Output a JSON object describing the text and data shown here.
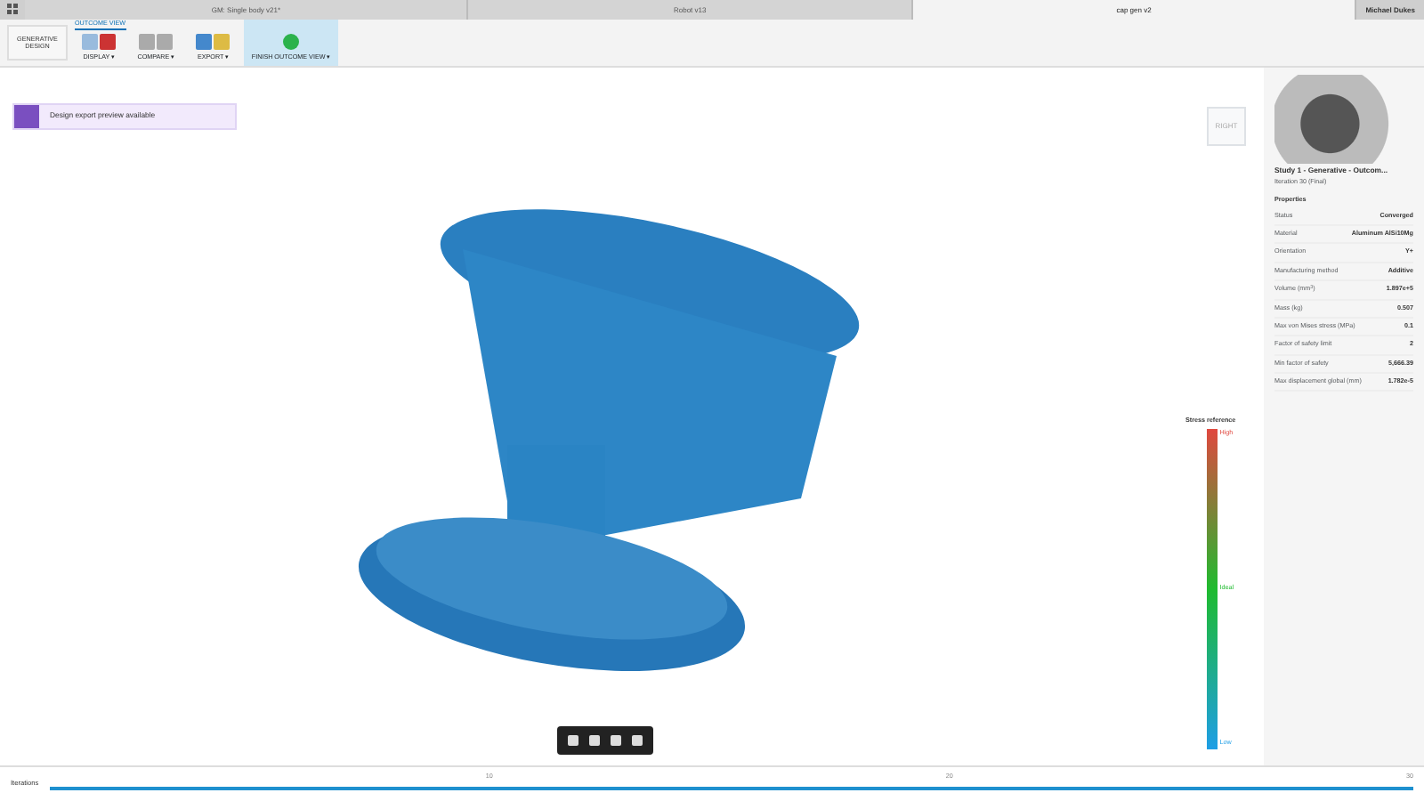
{
  "document_tabs": [
    {
      "label": "GM: Single body v21*",
      "selected": false
    },
    {
      "label": "Robot v13",
      "selected": false
    },
    {
      "label": "cap gen v2",
      "selected": true
    }
  ],
  "user": "Michael Dukes",
  "toolbar": {
    "workspace": "GENERATIVE DESIGN",
    "context_tab": "OUTCOME VIEW",
    "groups": [
      {
        "label": "DISPLAY ▾"
      },
      {
        "label": "COMPARE ▾"
      },
      {
        "label": "EXPORT ▾"
      },
      {
        "label": "FINISH OUTCOME VIEW ▾"
      }
    ]
  },
  "notification": "Design export preview available",
  "viewcube": "RIGHT",
  "legend": {
    "title": "Stress reference",
    "high": "High",
    "ideal": "Ideal",
    "low": "Low"
  },
  "outcome": {
    "title": "Study 1 - Generative - Outcom...",
    "subtitle": "Iteration 30 (Final)"
  },
  "properties": {
    "title": "Properties",
    "rows": [
      {
        "name": "Status",
        "value": "Converged"
      },
      {
        "name": "Material",
        "value": "Aluminum AlSi10Mg"
      },
      {
        "name": "Orientation",
        "value": "Y+"
      },
      {
        "name": "Manufacturing method",
        "value": "Additive"
      },
      {
        "name": "Volume (mm$^{3}$)",
        "value": "1.897e+5"
      },
      {
        "name": "Mass (kg)",
        "value": "0.507"
      },
      {
        "name": "Max von Mises stress (MPa)",
        "value": "0.1"
      },
      {
        "name": "Factor of safety limit",
        "value": "2"
      },
      {
        "name": "Min factor of safety",
        "value": "5,666.39"
      },
      {
        "name": "Max displacement global (mm)",
        "value": "1.782e-5"
      }
    ]
  },
  "iterations": {
    "label": "Iterations",
    "level": 1,
    "ticks": [
      "10",
      "20",
      "30"
    ]
  }
}
